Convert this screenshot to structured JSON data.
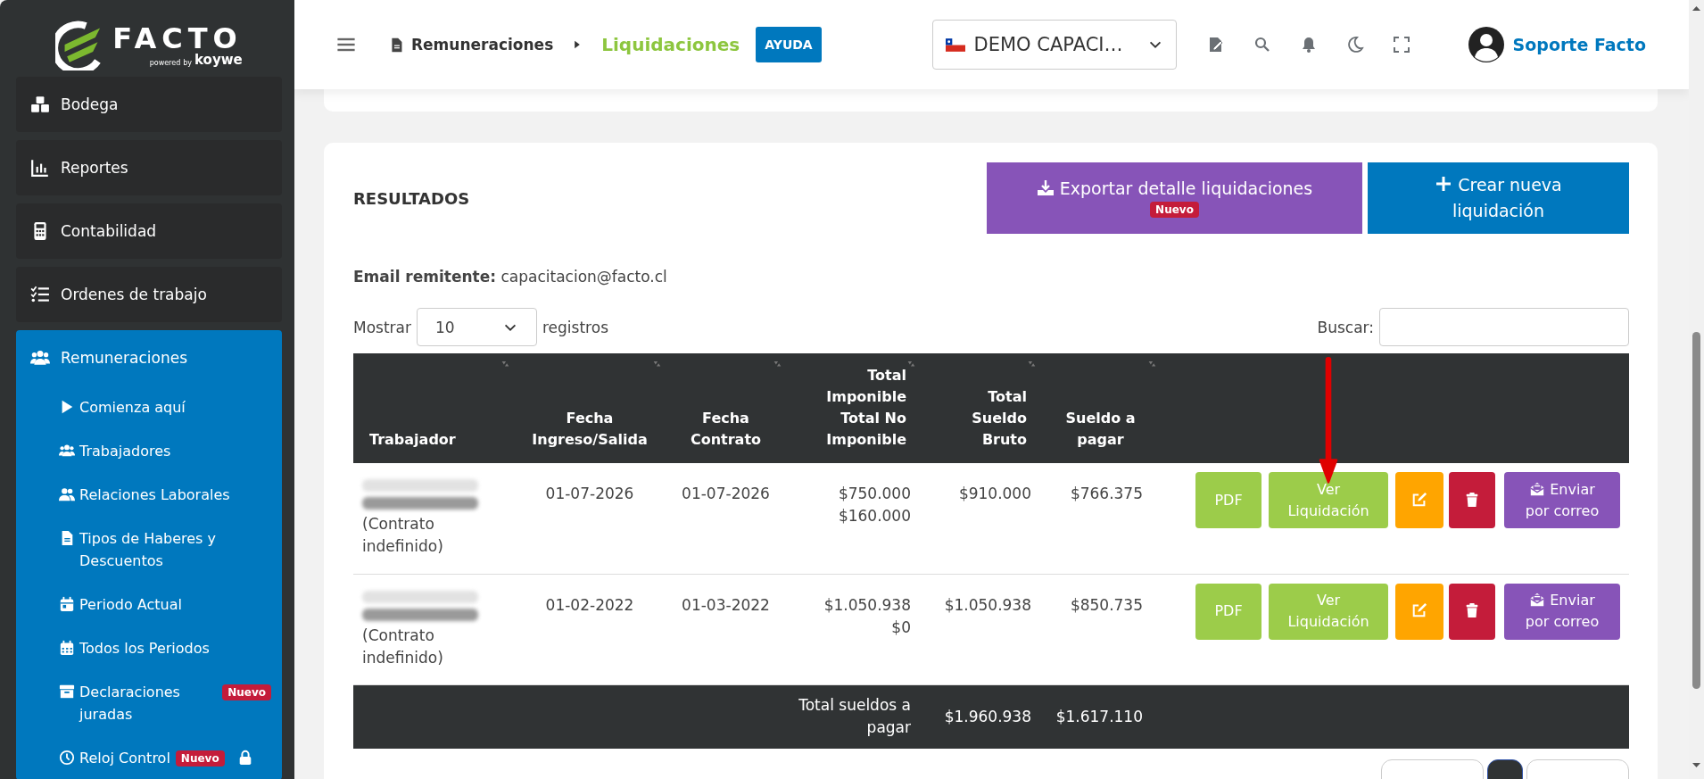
{
  "sidebar": {
    "logo": {
      "wordmark": "FACTO",
      "powered": "powered",
      "by": "by",
      "partner": "koywe"
    },
    "items": [
      {
        "label": "Bodega",
        "expanded": false
      },
      {
        "label": "Reportes",
        "expanded": false
      },
      {
        "label": "Contabilidad",
        "expanded": false
      },
      {
        "label": "Ordenes de trabajo",
        "expanded": false
      },
      {
        "label": "Remuneraciones",
        "expanded": true,
        "children": [
          {
            "label": "Comienza aquí",
            "locked": false
          },
          {
            "label": "Trabajadores",
            "locked": false
          },
          {
            "label": "Relaciones Laborales",
            "locked": false
          },
          {
            "label": "Tipos de Haberes y Descuentos",
            "locked": false
          },
          {
            "label": "Periodo Actual",
            "locked": false
          },
          {
            "label": "Todos los Periodos",
            "locked": false
          },
          {
            "label": "Declaraciones juradas",
            "badge": "Nuevo",
            "locked": false
          },
          {
            "label": "Reloj Control",
            "badge": "Nuevo",
            "locked": true
          }
        ]
      }
    ]
  },
  "header": {
    "breadcrumb": [
      {
        "label": "Remuneraciones",
        "current": false
      },
      {
        "label": "Liquidaciones",
        "current": true
      }
    ],
    "help_button": "AYUDA",
    "company": "DEMO CAPACI…",
    "user": "Soporte Facto"
  },
  "results": {
    "title": "RESULTADOS",
    "export_button": {
      "label": "Exportar detalle liquidaciones",
      "badge": "Nuevo"
    },
    "create_button": "Crear nueva liquidación",
    "email": {
      "label": "Email remitente:",
      "value": "capacitacion@facto.cl"
    },
    "page_length": {
      "prefix": "Mostrar",
      "value": "10",
      "suffix": "registros"
    },
    "search": {
      "label": "Buscar:"
    },
    "columns": [
      "Trabajador",
      "Fecha Ingreso/Salida",
      "Fecha Contrato",
      "Total Imponible Total No Imponible",
      "Total Sueldo Bruto",
      "Sueldo a pagar"
    ],
    "rows": [
      {
        "contract": "(Contrato indefinido)",
        "ingreso": "01-07-2026",
        "fecha_contrato": "01-07-2026",
        "imponible": "$750.000",
        "no_imponible": "$160.000",
        "bruto": "$910.000",
        "a_pagar": "$766.375",
        "actions": [
          {
            "kind": "text",
            "label": "PDF",
            "color": "#9ccc4a"
          },
          {
            "kind": "text",
            "label": "Ver Liquidación",
            "color": "#9ccc4a"
          },
          {
            "kind": "edit",
            "color": "#ffa500"
          },
          {
            "kind": "delete",
            "color": "#c41c3a"
          },
          {
            "kind": "mail",
            "label": "Enviar por correo",
            "color": "#8754b8"
          }
        ]
      },
      {
        "contract": "(Contrato indefinido)",
        "ingreso": "01-02-2022",
        "fecha_contrato": "01-03-2022",
        "imponible": "$1.050.938",
        "no_imponible": "$0",
        "bruto": "$1.050.938",
        "a_pagar": "$850.735",
        "actions": [
          {
            "kind": "text",
            "label": "PDF",
            "color": "#9ccc4a"
          },
          {
            "kind": "text",
            "label": "Ver Liquidación",
            "color": "#9ccc4a"
          },
          {
            "kind": "edit",
            "color": "#ffa500"
          },
          {
            "kind": "delete",
            "color": "#c41c3a"
          },
          {
            "kind": "mail",
            "label": "Enviar por correo",
            "color": "#8754b8"
          }
        ]
      }
    ],
    "totals": {
      "label": "Total sueldos a pagar",
      "bruto": "$1.960.938",
      "a_pagar": "$1.617.110"
    },
    "pagination": [
      {
        "selected": false
      },
      {
        "selected": true
      },
      {
        "selected": false
      }
    ]
  }
}
